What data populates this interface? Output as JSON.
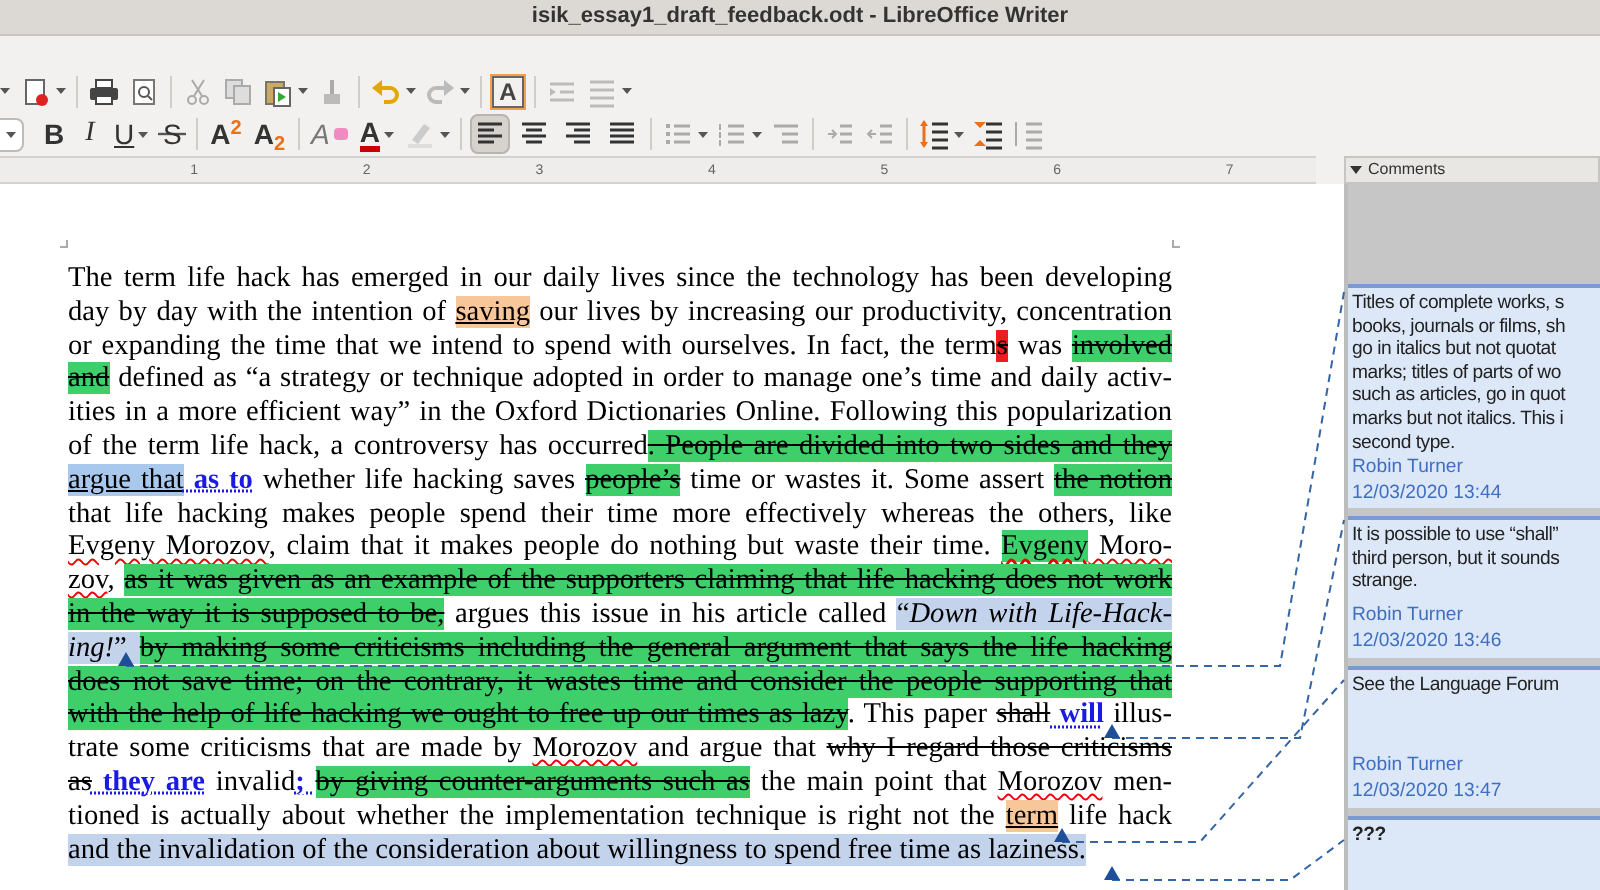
{
  "window": {
    "title": "isik_essay1_draft_feedback.odt - LibreOffice Writer"
  },
  "toolbar": {
    "text_box": "A",
    "bold": "B",
    "italic": "I",
    "underline": "U",
    "strikethrough": "S",
    "superscript": "A$^{2}$",
    "subscript": "A$_{2}$",
    "clear_formatting": "A",
    "font_color": "A",
    "alignment": [
      {
        "selected": true
      },
      {
        "selected": false
      },
      {
        "selected": false
      },
      {
        "selected": false
      }
    ]
  },
  "ruler": {
    "marks": [
      "1",
      "2",
      "3",
      "4",
      "5",
      "6",
      "7"
    ]
  },
  "document": {
    "lines": [
      [
        {
          "kind": "plain",
          "text": "The term life hack has emerged in our daily lives since the technology has been developing"
        }
      ],
      [
        {
          "kind": "plain",
          "text": "day by day with the intention of "
        },
        {
          "kind": "highlight",
          "text": "saving"
        },
        {
          "kind": "plain",
          "text": " our lives by increasing our productivity, concentration"
        }
      ],
      [
        {
          "kind": "plain",
          "text": "or expanding the time that we intend to spend with ourselves. In fact, the term"
        },
        {
          "kind": "deleted_red",
          "text": "s"
        },
        {
          "kind": "plain",
          "text": " was "
        },
        {
          "kind": "deleted_green",
          "text": "involved"
        }
      ],
      [
        {
          "kind": "deleted_green",
          "text": "and"
        },
        {
          "kind": "plain",
          "text": " defined as “a strategy or technique adopted in order to manage one’s time and daily activ-"
        }
      ],
      [
        {
          "kind": "plain",
          "text": "ities in a more efficient way” in the Oxford Dictionaries Online. Following this popularization"
        }
      ],
      [
        {
          "kind": "plain",
          "text": "of the term life hack, a controversy has occurred"
        },
        {
          "kind": "deleted_green",
          "text": ". People are divided into two sides and they"
        }
      ],
      [
        {
          "kind": "deleted_comment",
          "text": "argue that"
        },
        {
          "kind": "inserted",
          "text": " as to"
        },
        {
          "kind": "plain",
          "text": " whether life hacking saves "
        },
        {
          "kind": "deleted_green",
          "text": "people’s"
        },
        {
          "kind": "plain",
          "text": " time or wastes it. Some assert "
        },
        {
          "kind": "deleted_green",
          "text": "the notion"
        }
      ],
      [
        {
          "kind": "plain",
          "text": "that life hacking makes people spend their time more effectively whereas the others, like"
        }
      ],
      [
        {
          "kind": "misspelled",
          "text": "Evgeny Morozov"
        },
        {
          "kind": "plain",
          "text": ", claim that it makes people do nothing but waste their time. "
        },
        {
          "kind": "deleted_green_misspelled",
          "text": "Evgeny"
        },
        {
          "kind": "misspelled",
          "text": " Moro-"
        }
      ],
      [
        {
          "kind": "misspelled",
          "text": "zov"
        },
        {
          "kind": "plain",
          "text": ", "
        },
        {
          "kind": "deleted_green",
          "text": "as it was given as an example of the supporters claiming that life hacking does not work"
        }
      ],
      [
        {
          "kind": "deleted_green",
          "text": "in the way it is supposed to be,"
        },
        {
          "kind": "plain",
          "text": " argues this issue in his article called "
        },
        {
          "kind": "comment",
          "text": "“"
        },
        {
          "kind": "comment_italic",
          "text": "Down with Life-Hack-"
        }
      ],
      [
        {
          "kind": "comment_italic",
          "text": "ing!"
        },
        {
          "kind": "comment",
          "text": "” "
        },
        {
          "kind": "deleted_green",
          "text": "by making some criticisms including the general argument that says the life hacking"
        }
      ],
      [
        {
          "kind": "deleted_green",
          "text": "does not save time; on the contrary, it wastes time and consider the people supporting that"
        }
      ],
      [
        {
          "kind": "deleted_green",
          "text": "with the help of life hacking we ought to free up our times as lazy"
        },
        {
          "kind": "plain",
          "text": ". This paper "
        },
        {
          "kind": "deleted",
          "text": "shall"
        },
        {
          "kind": "inserted",
          "text": " will"
        },
        {
          "kind": "plain",
          "text": " illus-"
        }
      ],
      [
        {
          "kind": "plain",
          "text": "trate some criticisms that are made by "
        },
        {
          "kind": "misspelled",
          "text": "Morozov"
        },
        {
          "kind": "plain",
          "text": " and argue that "
        },
        {
          "kind": "deleted",
          "text": "why I regard those criticisms"
        }
      ],
      [
        {
          "kind": "deleted",
          "text": "as"
        },
        {
          "kind": "inserted",
          "text": " they are"
        },
        {
          "kind": "plain",
          "text": " invalid"
        },
        {
          "kind": "inserted",
          "text": "; "
        },
        {
          "kind": "deleted_green",
          "text": "by giving counter-arguments such as"
        },
        {
          "kind": "plain",
          "text": " the main point that "
        },
        {
          "kind": "misspelled",
          "text": "Morozov"
        },
        {
          "kind": "plain",
          "text": " men-"
        }
      ],
      [
        {
          "kind": "plain",
          "text": "tioned is actually about whether the implementation technique is right not the "
        },
        {
          "kind": "highlight",
          "text": "term"
        },
        {
          "kind": "plain",
          "text": " life hack"
        }
      ],
      [
        {
          "kind": "comment",
          "text": "and the invalidation of the consideration about willingness to spend free time as laziness."
        }
      ]
    ]
  },
  "comments_panel": {
    "header": "Comments",
    "comments": [
      {
        "bold": false,
        "lines": [
          "Titles of complete works, s",
          "books, journals or films, sh",
          "go in italics but not quotat",
          "marks; titles of parts of wo",
          "such as articles, go in quot",
          "marks but not italics. This i",
          "second type."
        ],
        "author": "Robin Turner",
        "date": "12/03/2020 13:44"
      },
      {
        "bold": false,
        "lines": [
          "It is possible to use “shall”",
          "third person, but it sounds",
          "strange."
        ],
        "author": "Robin Turner",
        "date": "12/03/2020 13:46"
      },
      {
        "bold": false,
        "lines": [
          "See the Language Forum"
        ],
        "author": "Robin Turner",
        "date": "12/03/2020 13:47"
      },
      {
        "bold": true,
        "lines": [
          "???"
        ]
      }
    ]
  }
}
